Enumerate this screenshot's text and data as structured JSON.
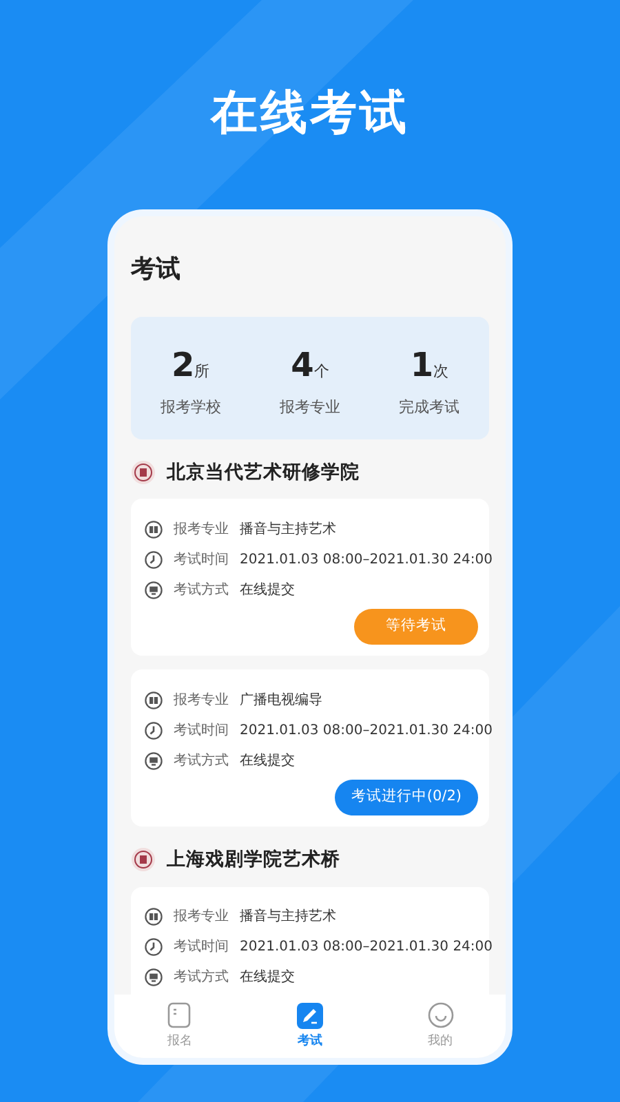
{
  "headline": "在线考试",
  "page_title": "考试",
  "stats": [
    {
      "value": "2",
      "unit": "所",
      "label": "报考学校"
    },
    {
      "value": "4",
      "unit": "个",
      "label": "报考专业"
    },
    {
      "value": "1",
      "unit": "次",
      "label": "完成考试"
    }
  ],
  "schools": [
    {
      "name": "北京当代艺术研修学院",
      "exams": [
        {
          "rows": [
            {
              "kind": "major",
              "label": "报考专业",
              "value": "播音与主持艺术"
            },
            {
              "kind": "time",
              "label": "考试时间",
              "value": "2021.01.03 08:00–2021.01.30 24:00"
            },
            {
              "kind": "method",
              "label": "考试方式",
              "value": "在线提交"
            }
          ],
          "button": {
            "kind": "waiting",
            "label": "等待考试"
          }
        },
        {
          "rows": [
            {
              "kind": "major",
              "label": "报考专业",
              "value": "广播电视编导"
            },
            {
              "kind": "time",
              "label": "考试时间",
              "value": "2021.01.03 08:00–2021.01.30 24:00"
            },
            {
              "kind": "method",
              "label": "考试方式",
              "value": "在线提交"
            }
          ],
          "button": {
            "kind": "ongoing",
            "label": "考试进行中(0/2)"
          }
        }
      ]
    },
    {
      "name": "上海戏剧学院艺术桥",
      "exams": [
        {
          "rows": [
            {
              "kind": "major",
              "label": "报考专业",
              "value": "播音与主持艺术"
            },
            {
              "kind": "time",
              "label": "考试时间",
              "value": "2021.01.03 08:00–2021.01.30 24:00"
            },
            {
              "kind": "method",
              "label": "考试方式",
              "value": "在线提交"
            }
          ]
        }
      ]
    }
  ],
  "tab_bar": [
    {
      "kind": "signup",
      "label": "报名",
      "selected": false
    },
    {
      "kind": "exam",
      "label": "考试",
      "selected": true
    },
    {
      "kind": "mine",
      "label": "我的",
      "selected": false
    }
  ]
}
